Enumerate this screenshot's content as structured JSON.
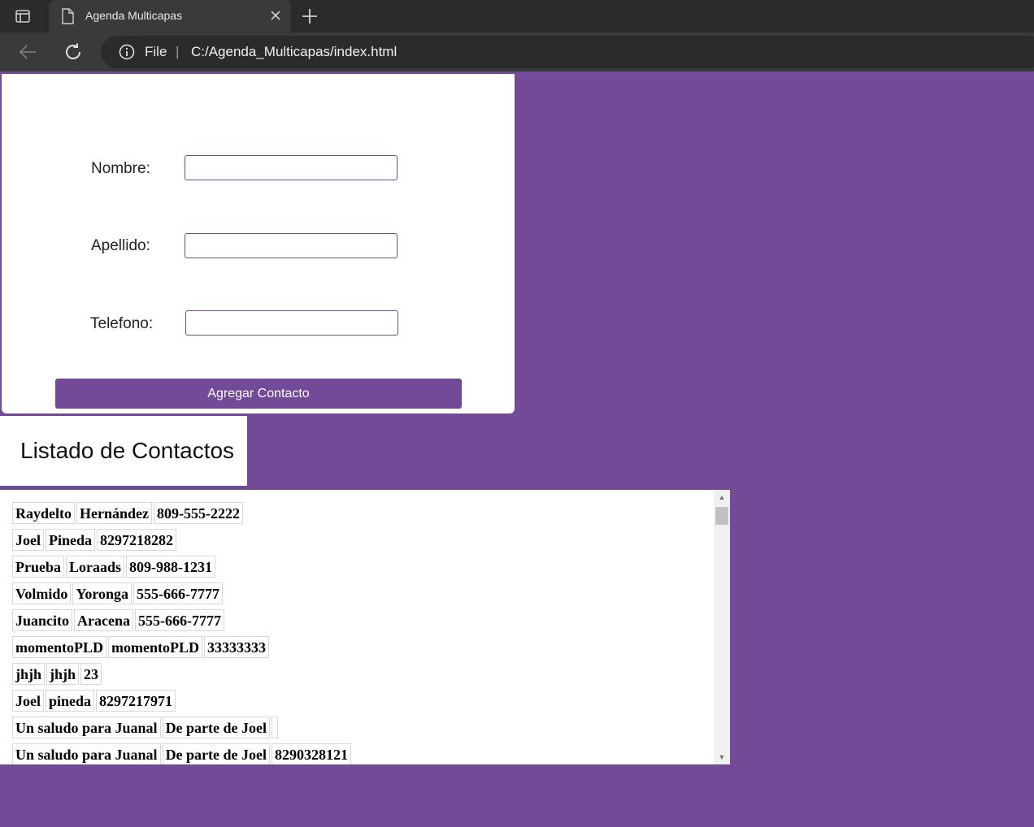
{
  "browser": {
    "tab_title": "Agenda Multicapas",
    "scheme_label": "File",
    "separator": "|",
    "url": "C:/Agenda_Multicapas/index.html"
  },
  "form": {
    "nombre_label": "Nombre:",
    "nombre_value": "",
    "apellido_label": "Apellido:",
    "apellido_value": "",
    "telefono_label": "Telefono:",
    "telefono_value": "",
    "submit_label": "Agregar Contacto"
  },
  "list": {
    "title": "Listado de Contactos",
    "contacts": [
      {
        "nombre": "Raydelto",
        "apellido": "Hernández",
        "telefono": "809-555-2222"
      },
      {
        "nombre": "Joel",
        "apellido": "Pineda",
        "telefono": "8297218282"
      },
      {
        "nombre": "Prueba",
        "apellido": "Loraads",
        "telefono": "809-988-1231"
      },
      {
        "nombre": "Volmido",
        "apellido": "Yoronga",
        "telefono": "555-666-7777"
      },
      {
        "nombre": "Juancito",
        "apellido": "Aracena",
        "telefono": "555-666-7777"
      },
      {
        "nombre": "momentoPLD",
        "apellido": "momentoPLD",
        "telefono": "33333333"
      },
      {
        "nombre": "jhjh",
        "apellido": "jhjh",
        "telefono": "23"
      },
      {
        "nombre": "Joel",
        "apellido": "pineda",
        "telefono": "8297217971"
      },
      {
        "nombre": "Un saludo para Juanal",
        "apellido": "De parte de Joel",
        "telefono": ""
      },
      {
        "nombre": "Un saludo para Juanal",
        "apellido": "De parte de Joel",
        "telefono": "8290328121"
      }
    ]
  },
  "colors": {
    "page_background": "#734a98",
    "accent": "#734a98"
  }
}
